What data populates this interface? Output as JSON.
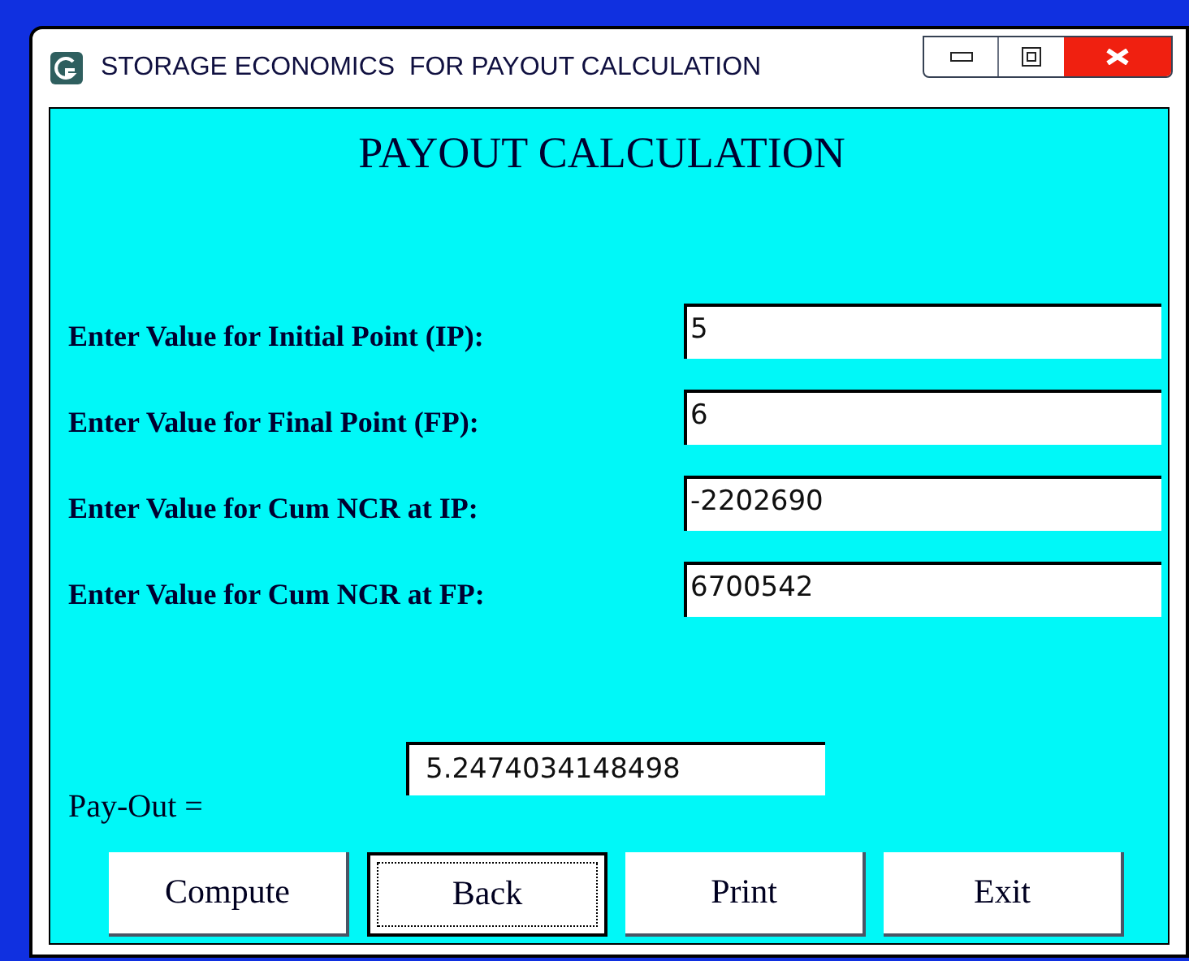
{
  "window": {
    "title": "STORAGE ECONOMICS  FOR PAYOUT CALCULATION"
  },
  "heading": "PAYOUT CALCULATION",
  "fields": [
    {
      "label": "Enter Value for Initial Point (IP):",
      "value": "5"
    },
    {
      "label": "Enter Value for Final Point (FP):",
      "value": "6"
    },
    {
      "label": "Enter Value for Cum NCR at IP:",
      "value": "-2202690"
    },
    {
      "label": "Enter Value for Cum NCR at FP:",
      "value": "6700542"
    }
  ],
  "result": {
    "label": "Pay-Out =",
    "value": "5.2474034148498"
  },
  "buttons": [
    {
      "label": "Compute",
      "focused": false
    },
    {
      "label": "Back",
      "focused": true
    },
    {
      "label": "Print",
      "focused": false
    },
    {
      "label": "Exit",
      "focused": false
    }
  ]
}
